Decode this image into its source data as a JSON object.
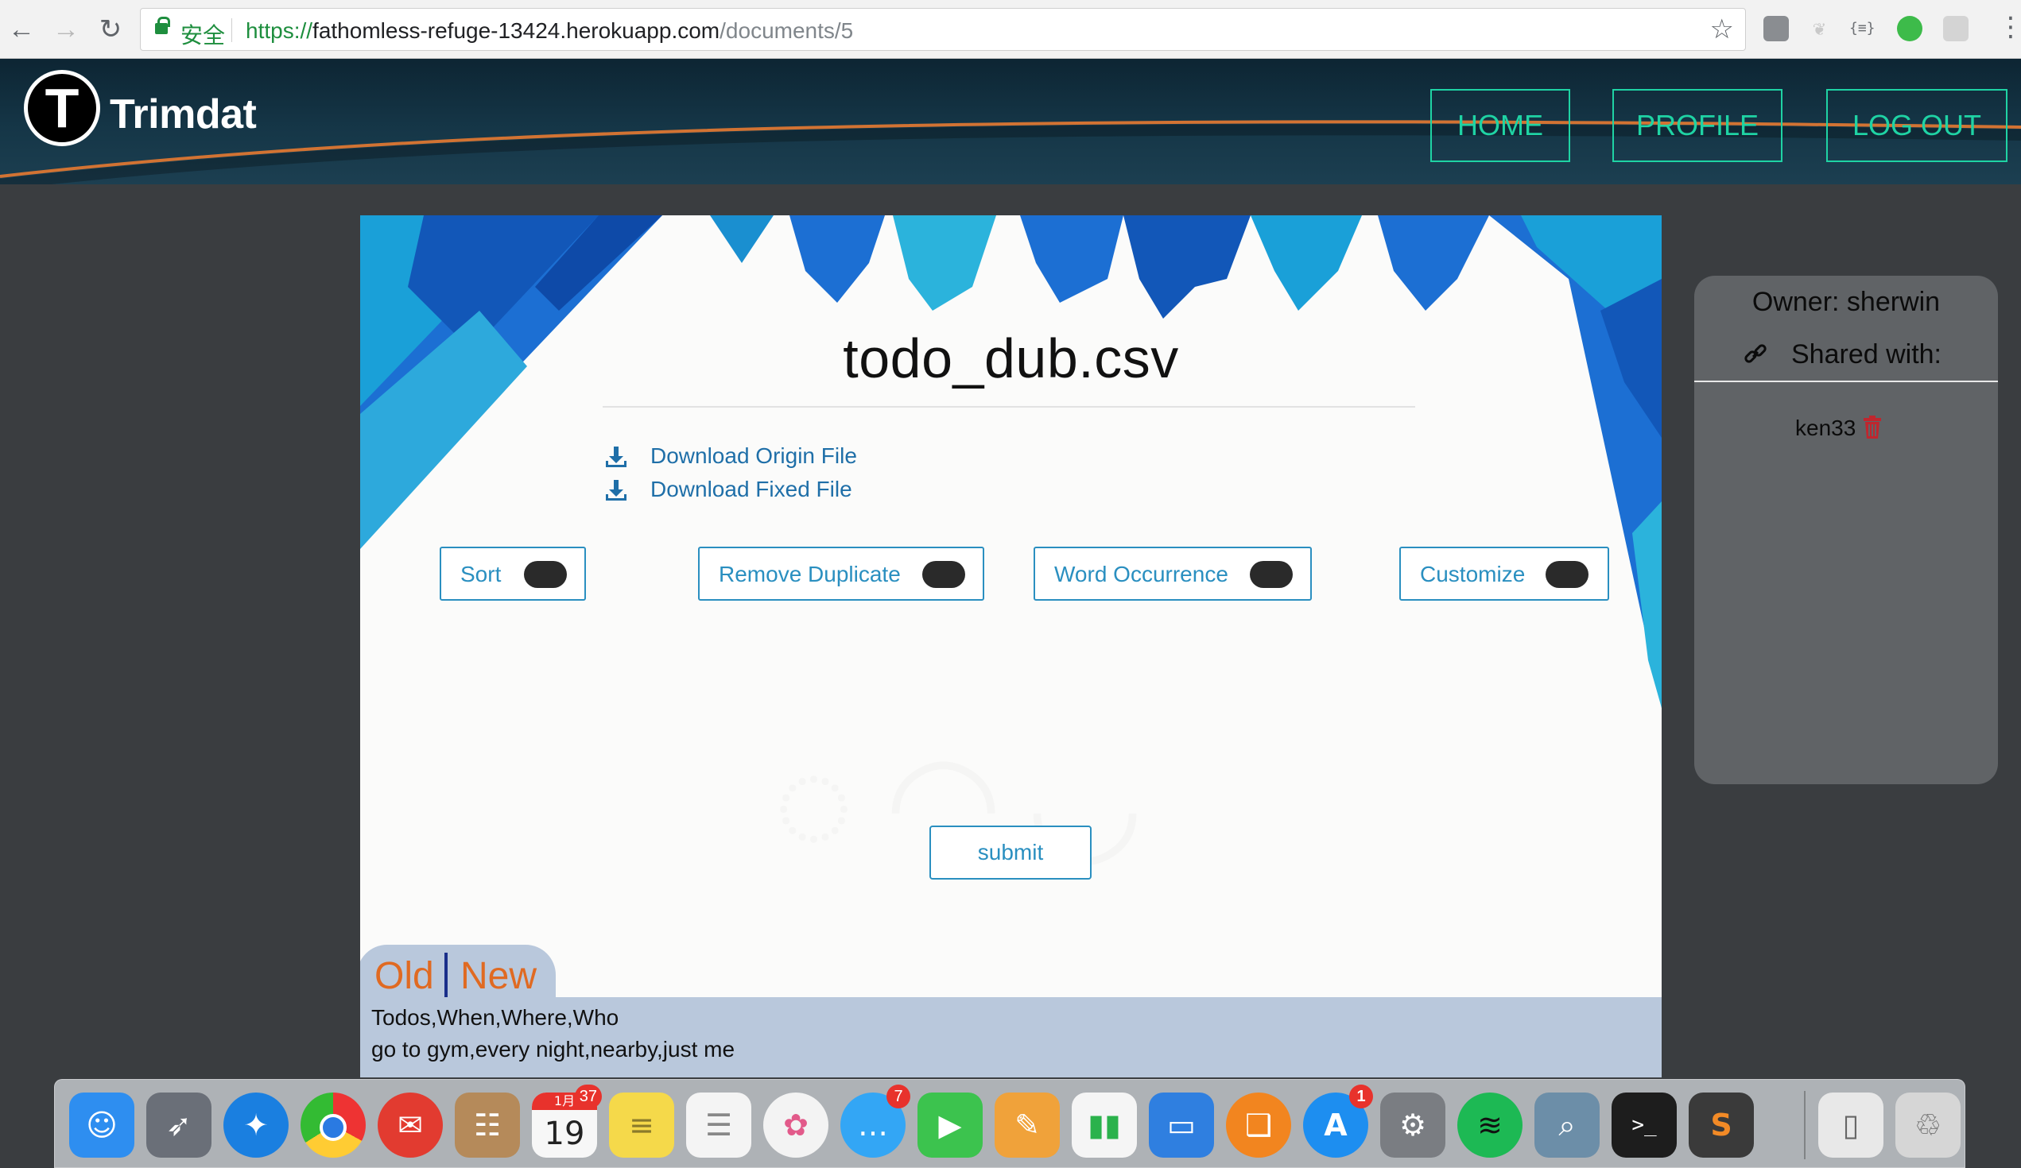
{
  "browser": {
    "back_icon": "arrow-left",
    "forward_icon": "arrow-right",
    "reload_icon": "reload",
    "secure_label": "安全",
    "url_scheme": "https://",
    "url_host": "fathomless-refuge-13424.herokuapp.com",
    "url_path": "/documents/5",
    "bookmark_icon": "star",
    "extensions": [
      "extension-square",
      "extension-feather",
      "json-viewer",
      "evernote",
      "react-devtools"
    ],
    "json_ext_label": "{≡}",
    "menu_icon": "vertical-dots"
  },
  "header": {
    "logo_letter": "T",
    "brand": "Trimdat",
    "nav": [
      {
        "label": "HOME"
      },
      {
        "label": "PROFILE"
      },
      {
        "label": "LOG OUT"
      }
    ],
    "accent_color": "#1fd3a4"
  },
  "document": {
    "title": "todo_dub.csv",
    "downloads": [
      {
        "label": "Download Origin File",
        "icon": "download-icon"
      },
      {
        "label": "Download Fixed File",
        "icon": "download-icon"
      }
    ],
    "options": [
      {
        "label": "Sort",
        "enabled": true
      },
      {
        "label": "Remove Duplicate",
        "enabled": true
      },
      {
        "label": "Word Occurrence",
        "enabled": true
      },
      {
        "label": "Customize",
        "enabled": true
      }
    ],
    "submit_label": "submit",
    "view_tabs": {
      "old": "Old",
      "new": "New"
    },
    "preview_lines": [
      "Todos,When,Where,Who",
      "go to gym,every night,nearby,just me"
    ]
  },
  "sharing": {
    "owner_label": "Owner: sherwin",
    "shared_with_label": "Shared with:",
    "users": [
      {
        "name": "ken33",
        "icon": "trash-icon",
        "icon_color": "#c0262e"
      }
    ]
  },
  "dock": {
    "apps": [
      {
        "name": "finder",
        "glyph": "☺",
        "color": "#2e8ef0"
      },
      {
        "name": "launchpad",
        "glyph": "🚀",
        "color": "#6a6f78"
      },
      {
        "name": "safari",
        "glyph": "⊘",
        "color": "#1a7fe0"
      },
      {
        "name": "chrome",
        "glyph": "◉",
        "color": "#e9b32b"
      },
      {
        "name": "mail-client",
        "glyph": "✉",
        "color": "#e23b30"
      },
      {
        "name": "contacts",
        "glyph": "☷",
        "color": "#b58a5a"
      },
      {
        "name": "calendar",
        "glyph": "19",
        "color": "#f7f7f7",
        "badge": "37",
        "month": "1月"
      },
      {
        "name": "notes",
        "glyph": "≡",
        "color": "#f5d94a"
      },
      {
        "name": "reminders",
        "glyph": "☰",
        "color": "#f4f4f4"
      },
      {
        "name": "photos",
        "glyph": "✿",
        "color": "#f3f3f3"
      },
      {
        "name": "messages",
        "glyph": "…",
        "color": "#33a6f5",
        "badge": "7"
      },
      {
        "name": "facetime",
        "glyph": "▶",
        "color": "#3cc34e"
      },
      {
        "name": "pages",
        "glyph": "✎",
        "color": "#f0a23a"
      },
      {
        "name": "numbers",
        "glyph": "▮",
        "color": "#2bb24c"
      },
      {
        "name": "keynote",
        "glyph": "▭",
        "color": "#2f7fe0"
      },
      {
        "name": "ibooks",
        "glyph": "❑",
        "color": "#f2851f"
      },
      {
        "name": "app-store",
        "glyph": "A",
        "color": "#1d8ef0",
        "badge": "1"
      },
      {
        "name": "system-preferences",
        "glyph": "⚙",
        "color": "#7a7d82"
      },
      {
        "name": "spotify",
        "glyph": "≋",
        "color": "#1db954"
      },
      {
        "name": "preview",
        "glyph": "⌕",
        "color": "#6c8ea8"
      },
      {
        "name": "terminal",
        "glyph": ">_",
        "color": "#1d1d1d"
      },
      {
        "name": "sublime-text",
        "glyph": "S",
        "color": "#3a3a3a"
      },
      {
        "name": "archive-utility",
        "glyph": "▯",
        "color": "#e8e8e8"
      },
      {
        "name": "trash",
        "glyph": "🗑",
        "color": "#d6d6d6"
      }
    ]
  }
}
